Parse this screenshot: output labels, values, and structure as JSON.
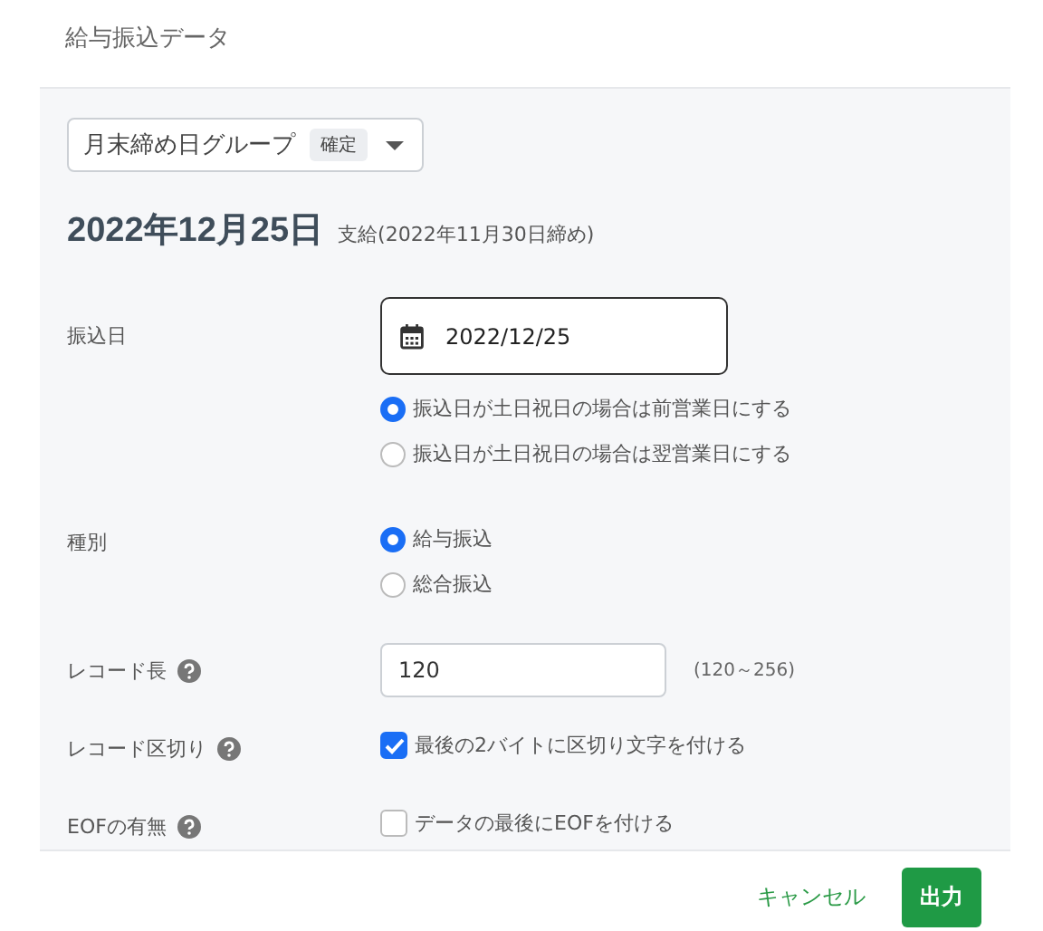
{
  "dialog": {
    "title": "給与振込データ"
  },
  "group_select": {
    "value": "月末締め日グループ",
    "badge": "確定"
  },
  "payday": {
    "date": "2022年12月25日",
    "note": "支給(2022年11月30日締め)"
  },
  "fields": [
    {
      "kind": "date",
      "label": "振込日",
      "help": false,
      "value": "2022/12/25",
      "options": [
        {
          "label": "振込日が土日祝日の場合は前営業日にする",
          "selected": true
        },
        {
          "label": "振込日が土日祝日の場合は翌営業日にする",
          "selected": false
        }
      ]
    },
    {
      "kind": "radio",
      "label": "種別",
      "help": false,
      "options": [
        {
          "label": "給与振込",
          "selected": true
        },
        {
          "label": "総合振込",
          "selected": false
        }
      ]
    },
    {
      "kind": "number",
      "label": "レコード長",
      "help": true,
      "value": "120",
      "hint": "(120～256)"
    },
    {
      "kind": "checkbox",
      "label": "レコード区切り",
      "help": true,
      "checked": true,
      "text": "最後の2バイトに区切り文字を付ける"
    },
    {
      "kind": "checkbox",
      "label": "EOFの有無",
      "help": true,
      "checked": false,
      "text": "データの最後にEOFを付ける"
    }
  ],
  "buttons": [
    {
      "label": "キャンセル",
      "kind": "text"
    },
    {
      "label": "出力",
      "kind": "primary"
    }
  ]
}
